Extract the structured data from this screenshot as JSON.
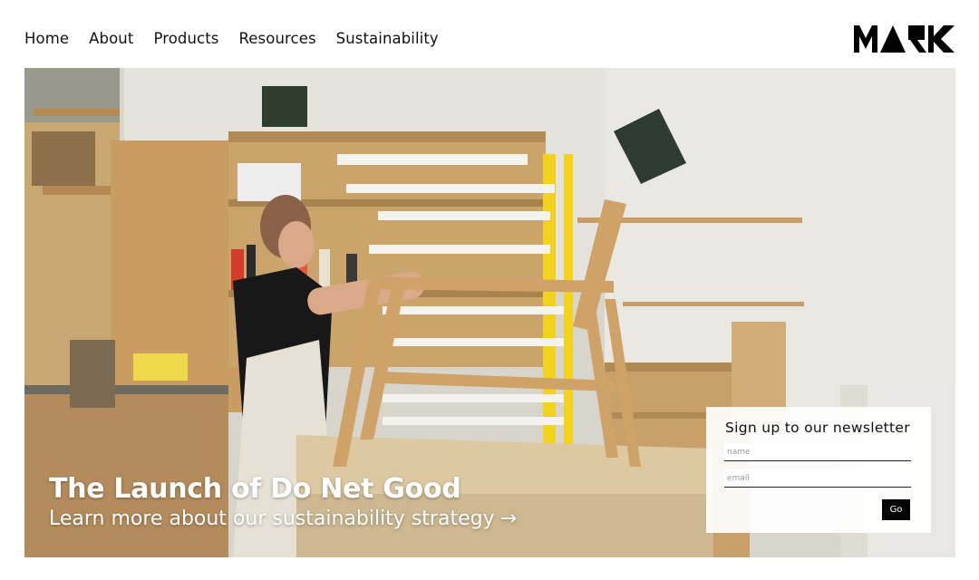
{
  "nav": {
    "items": [
      {
        "label": "Home"
      },
      {
        "label": "About"
      },
      {
        "label": "Products"
      },
      {
        "label": "Resources"
      },
      {
        "label": "Sustainability"
      }
    ]
  },
  "brand": {
    "logo_text": "MARK"
  },
  "hero": {
    "title": "The Launch of Do Net Good",
    "link_label": "Learn more about our sustainability strategy",
    "arrow": "→"
  },
  "newsletter": {
    "title": "Sign up to our newsletter",
    "name_placeholder": "name",
    "email_placeholder": "email",
    "go_label": "Go"
  },
  "colors": {
    "background": "#ffffff",
    "text": "#111111",
    "button": "#050505",
    "accent_yellow": "#f2d21b"
  }
}
